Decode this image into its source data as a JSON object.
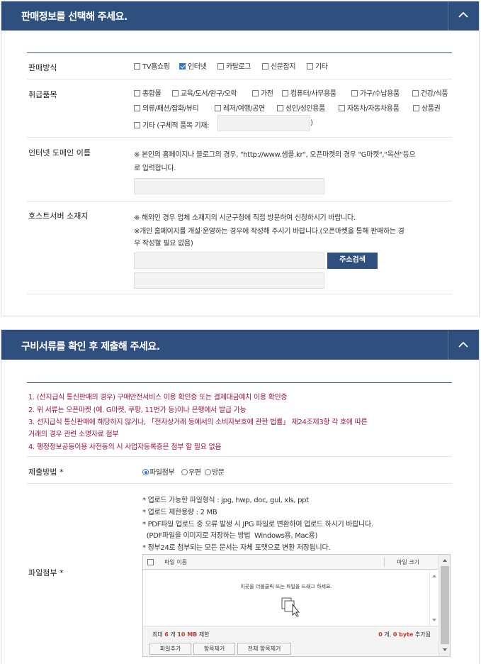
{
  "sales_panel": {
    "title": "판매정보를 선택해 주세요.",
    "sales_method": {
      "label": "판매방식",
      "options": [
        {
          "label": "TV홈쇼핑",
          "checked": false
        },
        {
          "label": "인터넷",
          "checked": true
        },
        {
          "label": "카탈로그",
          "checked": false
        },
        {
          "label": "신문잡지",
          "checked": false
        },
        {
          "label": "기타",
          "checked": false
        }
      ]
    },
    "items": {
      "label": "취급품목",
      "options": [
        "종합몰",
        "교육/도서/완구/오락",
        "가전",
        "컴퓨터/사무용품",
        "가구/수납용품",
        "건강/식품",
        "의류/패션/잡화/뷰티",
        "레저/여행/공연",
        "성인/성인용품",
        "자동차/자동차용품",
        "상품권"
      ],
      "other_label": "기타 (구체적 품목 기재:",
      "other_close": ")"
    },
    "domain": {
      "label": "인터넷 도메인 이름",
      "note_line1": "※ 본인의 홈페이지나 블로그의 경우, \"http://www.샘플.kr\", 오픈마켓의 경우 \"G마켓\",\"옥션\"등으",
      "note_line2": "로 입력합니다."
    },
    "host": {
      "label": "호스트서버 소재지",
      "note_line1": "※ 해외인 경우 업체 소재지의 시군구청에 직접 방문하여 신청하시기 바랍니다.",
      "note_line2": "※개인 홈페이지를 개설·운영하는 경우에 작성해 주시기 바랍니다.(오픈마켓을 통해 판매하는 경",
      "note_line3": "우 작성할 필요 없음)",
      "search_button": "주소검색"
    }
  },
  "docs_panel": {
    "title": "구비서류를 확인 후 제출해 주세요.",
    "notices": [
      "1. (선지급식 통신판매의 경우) 구매안전서비스 이용 확인증 또는 결제대금예치 이용 확인증",
      "2. 위 서류는 오픈마켓 (예. G마켓, 쿠팡, 11번가 등)이나 은행에서 발급 가능",
      "3. 선지급식 통신판매에 해당하지 않거나, 「전자상거래 등에서의 소비자보호에 관한 법률」 제24조제3항 각 호에 따른",
      "거래의 경우 관련 소명자료 첨부",
      "4. 행정정보공동이용 사전동의 시 사업자등록증은 첨부 할 필요 없음"
    ],
    "submit_method": {
      "label": "제출방법 *",
      "options": [
        {
          "label": "파일첨부",
          "selected": true
        },
        {
          "label": "우편",
          "selected": false
        },
        {
          "label": "방문",
          "selected": false
        }
      ]
    },
    "attach": {
      "label": "파일첨부 *",
      "guide": [
        "* 업로드 가능한 파일형식 : jpg, hwp, doc, gul, xls, ppt",
        "* 업로드 제한용량 : 2 MB",
        "* PDF파일 업로드 중 오류 발생 시 JPG 파일로 변환하여 업로드 하시기 바랍니다.",
        "  (PDF파일을 이미지로 저장하는 방법  Windows용, Mac용)",
        "* 정부24로 첨부되는 모든 문서는 자체 포맷으로 변환 저장됩니다."
      ]
    },
    "uploader": {
      "col_name": "파일 이름",
      "col_size": "파일 크기",
      "drop_hint": "이곳을 더블클릭 또는 파일을 드래그 하세요.",
      "limit_prefix": "최대 ",
      "limit_count": "6",
      "limit_mid": " 개 ",
      "limit_size": "10 MB",
      "limit_suffix": " 제한",
      "added_count": "0",
      "added_mid": " 개, ",
      "added_size": "0 byte",
      "added_suffix": " 추가됨",
      "btn_add": "파일추가",
      "btn_remove": "항목제거",
      "btn_remove_all": "전체 항목제거"
    },
    "colors": {
      "accent": "#2f4f7f",
      "notice": "#9c1346",
      "limit_red": "#c0392b"
    }
  }
}
